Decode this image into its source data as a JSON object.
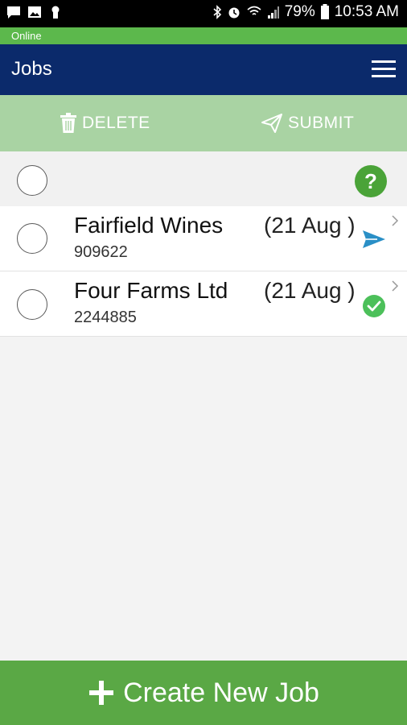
{
  "status_bar": {
    "battery": "79%",
    "time": "10:53 AM"
  },
  "connection": {
    "status": "Online"
  },
  "app_bar": {
    "title": "Jobs"
  },
  "actions": {
    "delete_label": "DELETE",
    "submit_label": "SUBMIT"
  },
  "jobs": [
    {
      "name": "Fairfield Wines",
      "number": "909622",
      "date": "(21 Aug )",
      "status_icon": "send-icon"
    },
    {
      "name": "Four Farms Ltd",
      "number": "2244885",
      "date": "(21 Aug )",
      "status_icon": "check-circle-icon"
    }
  ],
  "footer": {
    "create_label": "Create New Job"
  },
  "colors": {
    "app_bar": "#0b2a6b",
    "online": "#5cb84c",
    "action_bar": "#a9d3a3",
    "create_button": "#5aa845",
    "send": "#2a8fc6"
  }
}
